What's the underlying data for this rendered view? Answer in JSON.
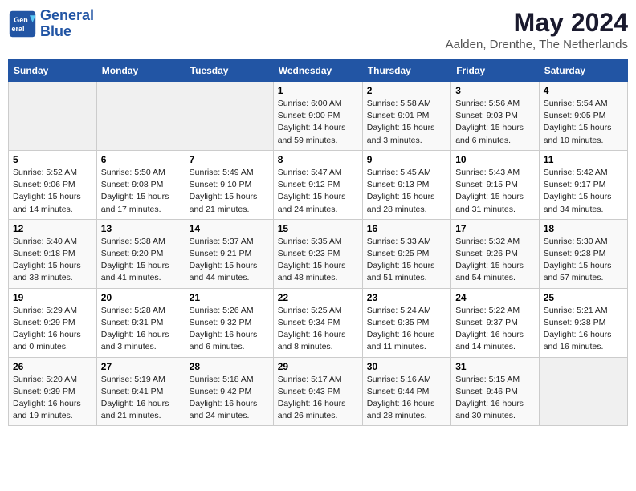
{
  "header": {
    "logo_line1": "General",
    "logo_line2": "Blue",
    "month": "May 2024",
    "location": "Aalden, Drenthe, The Netherlands"
  },
  "days_of_week": [
    "Sunday",
    "Monday",
    "Tuesday",
    "Wednesday",
    "Thursday",
    "Friday",
    "Saturday"
  ],
  "weeks": [
    [
      {
        "day": "",
        "info": ""
      },
      {
        "day": "",
        "info": ""
      },
      {
        "day": "",
        "info": ""
      },
      {
        "day": "1",
        "info": "Sunrise: 6:00 AM\nSunset: 9:00 PM\nDaylight: 14 hours\nand 59 minutes."
      },
      {
        "day": "2",
        "info": "Sunrise: 5:58 AM\nSunset: 9:01 PM\nDaylight: 15 hours\nand 3 minutes."
      },
      {
        "day": "3",
        "info": "Sunrise: 5:56 AM\nSunset: 9:03 PM\nDaylight: 15 hours\nand 6 minutes."
      },
      {
        "day": "4",
        "info": "Sunrise: 5:54 AM\nSunset: 9:05 PM\nDaylight: 15 hours\nand 10 minutes."
      }
    ],
    [
      {
        "day": "5",
        "info": "Sunrise: 5:52 AM\nSunset: 9:06 PM\nDaylight: 15 hours\nand 14 minutes."
      },
      {
        "day": "6",
        "info": "Sunrise: 5:50 AM\nSunset: 9:08 PM\nDaylight: 15 hours\nand 17 minutes."
      },
      {
        "day": "7",
        "info": "Sunrise: 5:49 AM\nSunset: 9:10 PM\nDaylight: 15 hours\nand 21 minutes."
      },
      {
        "day": "8",
        "info": "Sunrise: 5:47 AM\nSunset: 9:12 PM\nDaylight: 15 hours\nand 24 minutes."
      },
      {
        "day": "9",
        "info": "Sunrise: 5:45 AM\nSunset: 9:13 PM\nDaylight: 15 hours\nand 28 minutes."
      },
      {
        "day": "10",
        "info": "Sunrise: 5:43 AM\nSunset: 9:15 PM\nDaylight: 15 hours\nand 31 minutes."
      },
      {
        "day": "11",
        "info": "Sunrise: 5:42 AM\nSunset: 9:17 PM\nDaylight: 15 hours\nand 34 minutes."
      }
    ],
    [
      {
        "day": "12",
        "info": "Sunrise: 5:40 AM\nSunset: 9:18 PM\nDaylight: 15 hours\nand 38 minutes."
      },
      {
        "day": "13",
        "info": "Sunrise: 5:38 AM\nSunset: 9:20 PM\nDaylight: 15 hours\nand 41 minutes."
      },
      {
        "day": "14",
        "info": "Sunrise: 5:37 AM\nSunset: 9:21 PM\nDaylight: 15 hours\nand 44 minutes."
      },
      {
        "day": "15",
        "info": "Sunrise: 5:35 AM\nSunset: 9:23 PM\nDaylight: 15 hours\nand 48 minutes."
      },
      {
        "day": "16",
        "info": "Sunrise: 5:33 AM\nSunset: 9:25 PM\nDaylight: 15 hours\nand 51 minutes."
      },
      {
        "day": "17",
        "info": "Sunrise: 5:32 AM\nSunset: 9:26 PM\nDaylight: 15 hours\nand 54 minutes."
      },
      {
        "day": "18",
        "info": "Sunrise: 5:30 AM\nSunset: 9:28 PM\nDaylight: 15 hours\nand 57 minutes."
      }
    ],
    [
      {
        "day": "19",
        "info": "Sunrise: 5:29 AM\nSunset: 9:29 PM\nDaylight: 16 hours\nand 0 minutes."
      },
      {
        "day": "20",
        "info": "Sunrise: 5:28 AM\nSunset: 9:31 PM\nDaylight: 16 hours\nand 3 minutes."
      },
      {
        "day": "21",
        "info": "Sunrise: 5:26 AM\nSunset: 9:32 PM\nDaylight: 16 hours\nand 6 minutes."
      },
      {
        "day": "22",
        "info": "Sunrise: 5:25 AM\nSunset: 9:34 PM\nDaylight: 16 hours\nand 8 minutes."
      },
      {
        "day": "23",
        "info": "Sunrise: 5:24 AM\nSunset: 9:35 PM\nDaylight: 16 hours\nand 11 minutes."
      },
      {
        "day": "24",
        "info": "Sunrise: 5:22 AM\nSunset: 9:37 PM\nDaylight: 16 hours\nand 14 minutes."
      },
      {
        "day": "25",
        "info": "Sunrise: 5:21 AM\nSunset: 9:38 PM\nDaylight: 16 hours\nand 16 minutes."
      }
    ],
    [
      {
        "day": "26",
        "info": "Sunrise: 5:20 AM\nSunset: 9:39 PM\nDaylight: 16 hours\nand 19 minutes."
      },
      {
        "day": "27",
        "info": "Sunrise: 5:19 AM\nSunset: 9:41 PM\nDaylight: 16 hours\nand 21 minutes."
      },
      {
        "day": "28",
        "info": "Sunrise: 5:18 AM\nSunset: 9:42 PM\nDaylight: 16 hours\nand 24 minutes."
      },
      {
        "day": "29",
        "info": "Sunrise: 5:17 AM\nSunset: 9:43 PM\nDaylight: 16 hours\nand 26 minutes."
      },
      {
        "day": "30",
        "info": "Sunrise: 5:16 AM\nSunset: 9:44 PM\nDaylight: 16 hours\nand 28 minutes."
      },
      {
        "day": "31",
        "info": "Sunrise: 5:15 AM\nSunset: 9:46 PM\nDaylight: 16 hours\nand 30 minutes."
      },
      {
        "day": "",
        "info": ""
      }
    ]
  ]
}
